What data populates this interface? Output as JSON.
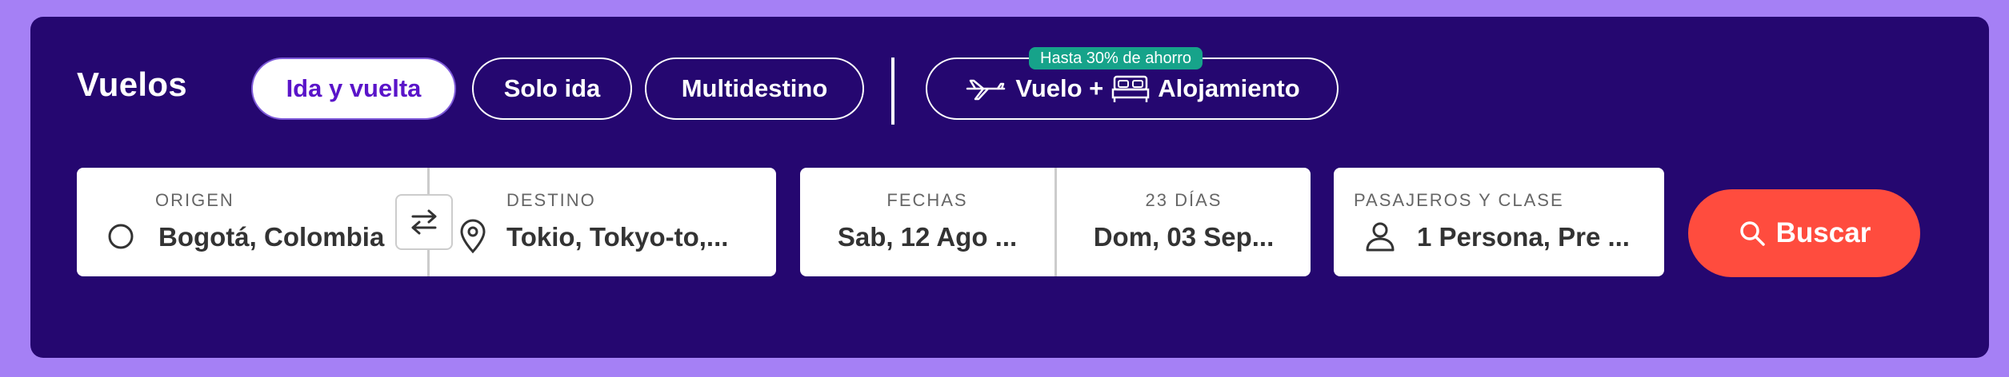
{
  "header": {
    "title": "Vuelos",
    "trip_types": [
      {
        "label": "Ida y vuelta",
        "active": true
      },
      {
        "label": "Solo ida",
        "active": false
      },
      {
        "label": "Multidestino",
        "active": false
      }
    ],
    "bundle": {
      "promo_badge": "Hasta 30% de ahorro",
      "label_part1": "Vuelo +",
      "label_part2": "Alojamiento",
      "icons": [
        "airplane-icon",
        "bed-icon"
      ]
    }
  },
  "search": {
    "origin": {
      "label": "ORIGEN",
      "value": "Bogotá, Colombia",
      "icon": "circle-icon"
    },
    "destination": {
      "label": "DESTINO",
      "value": "Tokio, Tokyo-to,...",
      "icon": "location-pin-icon"
    },
    "swap_icon": "swap-arrows-icon",
    "dates": {
      "label": "FECHAS",
      "departure": "Sab, 12 Ago ...",
      "duration_label": "23 DÍAS",
      "return": "Dom, 03 Sep..."
    },
    "passengers": {
      "label": "PASAJEROS Y CLASE",
      "value": "1 Persona, Pre ...",
      "icon": "person-icon"
    },
    "button": {
      "label": "Buscar",
      "icon": "search-icon"
    }
  },
  "colors": {
    "page_bg": "#a580f5",
    "panel_bg": "#250770",
    "accent_active_text": "#5a14c9",
    "promo_badge": "#16a38a",
    "search_button": "#ff4c3e"
  }
}
